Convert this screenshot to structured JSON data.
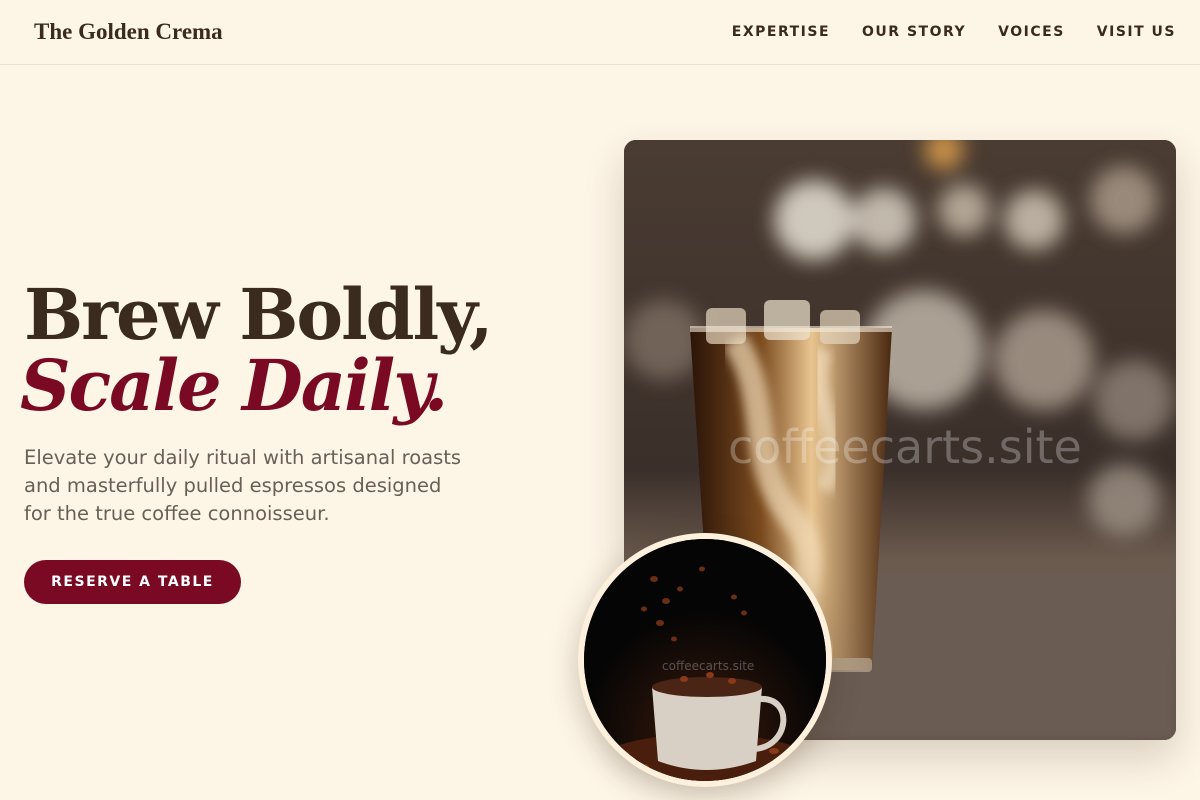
{
  "header": {
    "brand": "The Golden Crema",
    "nav": [
      "EXPERTISE",
      "OUR STORY",
      "VOICES",
      "VISIT US"
    ]
  },
  "hero": {
    "title_line1": "Brew Boldly,",
    "title_line2": "Scale Daily.",
    "description": "Elevate your daily ritual with artisanal roasts and masterfully pulled espressos designed for the true coffee connoisseur.",
    "cta_label": "RESERVE A TABLE"
  },
  "images": {
    "main_watermark": "coffeecarts.site",
    "round_watermark": "coffeecarts.site"
  },
  "colors": {
    "background": "#fdf5e6",
    "text_dark": "#3b2a1e",
    "accent": "#7a0a24",
    "body_text": "#6a5f57"
  }
}
